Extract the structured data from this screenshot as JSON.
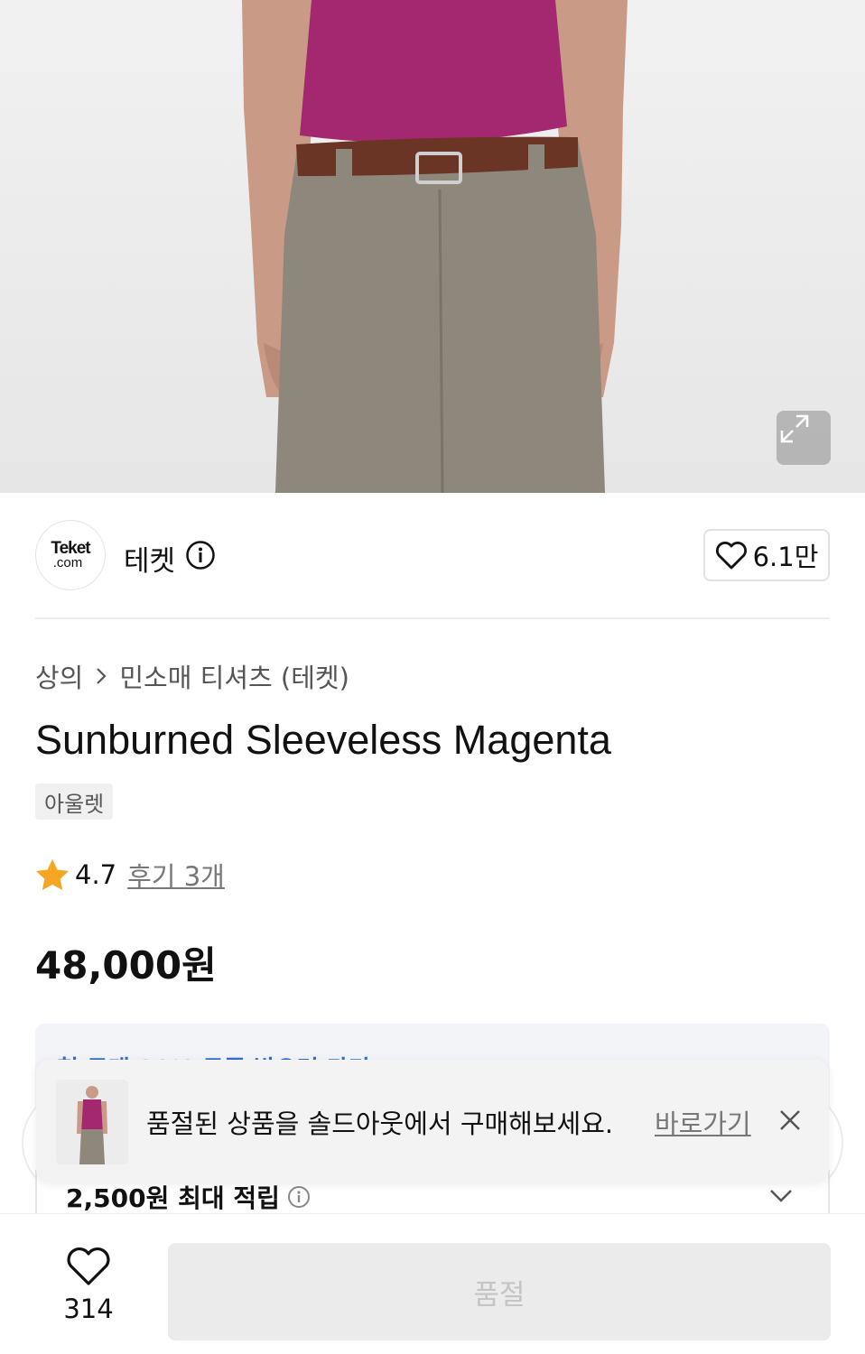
{
  "brand": {
    "logo_line1": "Teket",
    "logo_line2": ".com",
    "name": "테켓",
    "like_count": "6.1만"
  },
  "breadcrumb": {
    "level1": "상의",
    "level2": "민소매 티셔츠 (테켓)"
  },
  "product": {
    "title": "Sunburned Sleeveless Magenta",
    "tag": "아울렛",
    "rating": "4.7",
    "reviews": "후기 3개",
    "price": "48,000원"
  },
  "coupon": {
    "text": "첫 구매 20% 쿠폰 받으러 가기",
    "points": "2,500원 최대 적립"
  },
  "toast": {
    "message": "품절된 상품을 솔드아웃에서 구매해보세요.",
    "link": "바로가기"
  },
  "bottom_bar": {
    "wish_count": "314",
    "buy_label": "품절"
  },
  "icons": {
    "expand": "expand-icon",
    "info": "info-icon",
    "heart": "heart-icon",
    "star": "star-icon",
    "close": "close-icon",
    "chevron": "chevron-down-icon"
  },
  "colors": {
    "star": "#f5a623",
    "coupon_text": "#2f6fd8",
    "disabled_button": "#ebebeb"
  }
}
